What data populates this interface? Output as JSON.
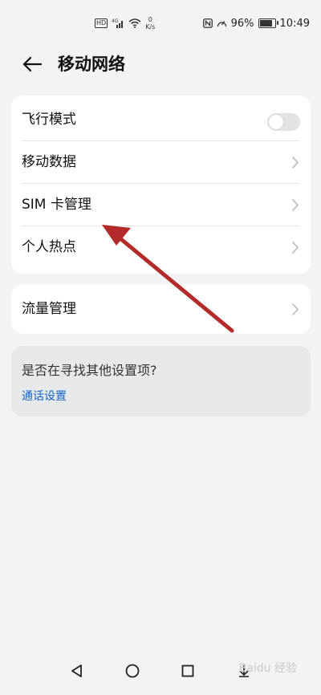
{
  "status_bar": {
    "carrier_badge": "HD",
    "network_type": "4G",
    "net_speed_value": "0",
    "net_speed_unit": "K/s",
    "battery_percent": "96%",
    "battery_level": 0.96,
    "time": "10:49"
  },
  "header": {
    "title": "移动网络"
  },
  "settings_group_1": {
    "items": [
      {
        "label": "飞行模式",
        "control": "toggle",
        "toggle_on": false
      },
      {
        "label": "移动数据",
        "control": "chevron"
      },
      {
        "label": "SIM 卡管理",
        "control": "chevron"
      },
      {
        "label": "个人热点",
        "control": "chevron"
      }
    ]
  },
  "settings_group_2": {
    "items": [
      {
        "label": "流量管理",
        "control": "chevron"
      }
    ]
  },
  "suggestion": {
    "question": "是否在寻找其他设置项?",
    "link": "通话设置"
  },
  "colors": {
    "background": "#f1f3f5",
    "card": "#ffffff",
    "link": "#1465cc",
    "annotation_arrow": "#b32a2a"
  },
  "watermark": "Baidu 经验"
}
